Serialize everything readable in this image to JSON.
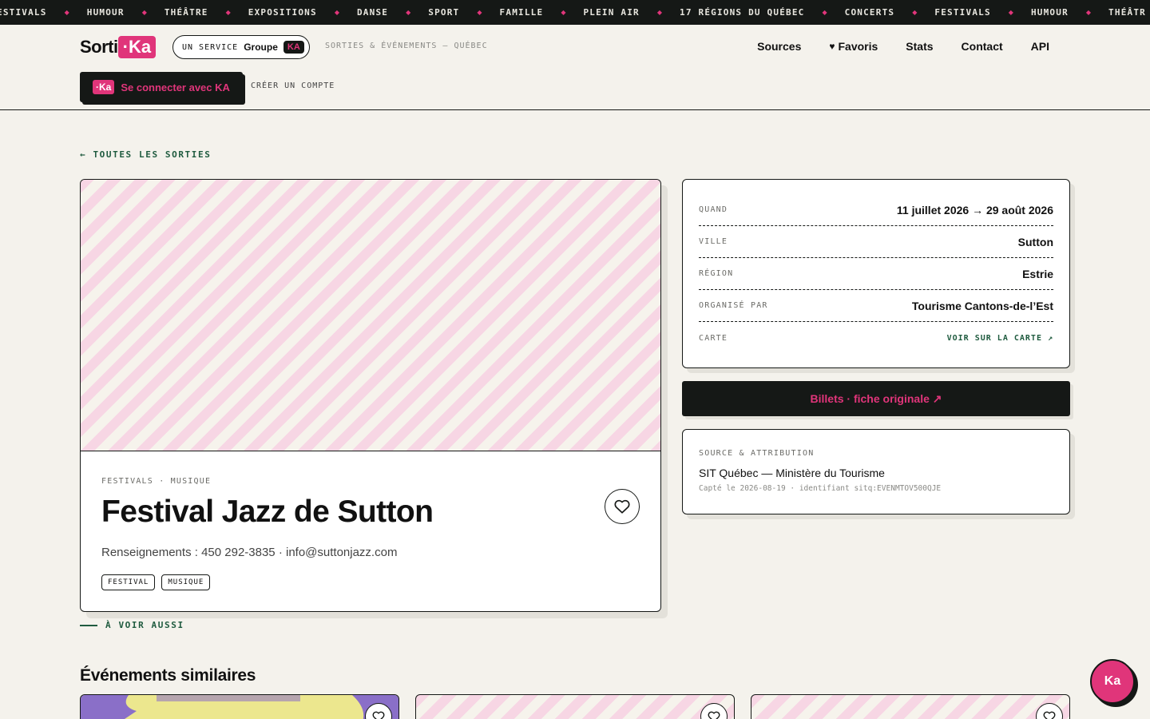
{
  "ticker": {
    "items": [
      "ESTIVALS",
      "HUMOUR",
      "THÉÂTRE",
      "EXPOSITIONS",
      "DANSE",
      "SPORT",
      "FAMILLE",
      "PLEIN AIR",
      "17 RÉGIONS DU QUÉBEC",
      "CONCERTS",
      "FESTIVALS",
      "HUMOUR",
      "THÉÂTR"
    ],
    "separator": "◆"
  },
  "header": {
    "logo_text": "Sorti",
    "logo_ka": "·Ka",
    "service_label": "UN SERVICE",
    "service_groupe": "Groupe",
    "service_ka": "KA",
    "tagline": "SORTIES & ÉVÉNEMENTS — QUÉBEC",
    "nav": {
      "sources": "Sources",
      "favoris": "Favoris",
      "stats": "Stats",
      "contact": "Contact",
      "api": "API"
    },
    "login_ka": "·Ka",
    "login_label": "Se connecter avec KA",
    "create_account": "CRÉER UN COMPTE"
  },
  "back_link": "← TOUTES LES SORTIES",
  "event": {
    "categories": "FESTIVALS · MUSIQUE",
    "title": "Festival Jazz de Sutton",
    "info": "Renseignements : 450 292-3835 · info@suttonjazz.com",
    "tags": [
      "FESTIVAL",
      "MUSIQUE"
    ]
  },
  "details": {
    "when_label": "QUAND",
    "when_value": "11 juillet 2026 → 29 août 2026",
    "city_label": "VILLE",
    "city_value": "Sutton",
    "region_label": "RÉGION",
    "region_value": "Estrie",
    "organizer_label": "ORGANISÉ PAR",
    "organizer_value": "Tourisme Cantons-de-l’Est",
    "map_label": "CARTE",
    "map_link": "VOIR SUR LA CARTE ↗"
  },
  "tickets_button": "Billets · fiche originale ↗",
  "source": {
    "title": "SOURCE & ATTRIBUTION",
    "name": "SIT Québec — Ministère du Tourisme",
    "meta": "Capté le 2026-08-19 · identifiant sitq:EVENMTOV500QJE"
  },
  "see_also": "À VOIR AUSSI",
  "similar_title": "Événements similaires",
  "chat_label": "Ka",
  "colors": {
    "accent": "#e0357a",
    "dark": "#151816",
    "green": "#1f5b3f",
    "background": "#f4f2ec"
  }
}
